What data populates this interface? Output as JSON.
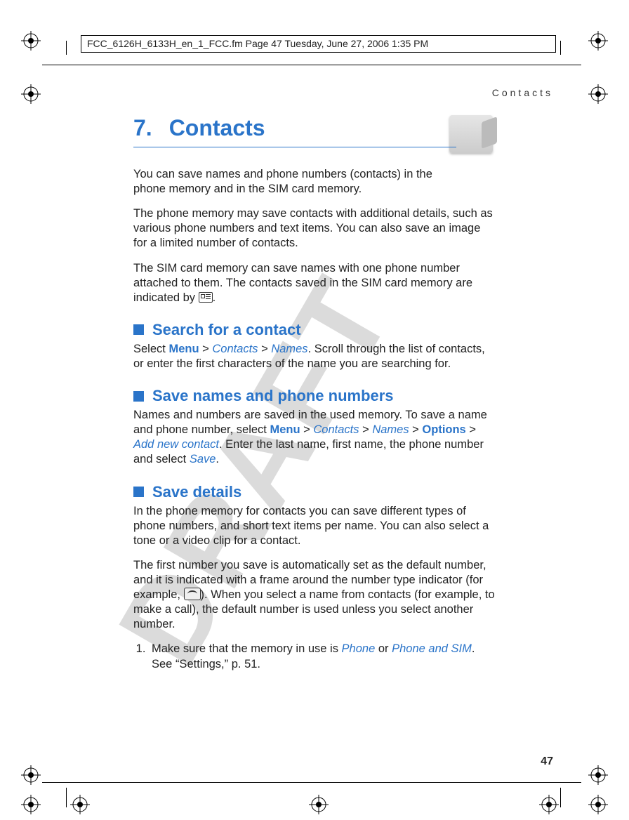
{
  "header": "FCC_6126H_6133H_en_1_FCC.fm  Page 47  Tuesday, June 27, 2006  1:35 PM",
  "running_header": "Contacts",
  "chapter": {
    "num": "7.",
    "title": "Contacts"
  },
  "watermark": "DRAFT",
  "p1": "You can save names and phone numbers (contacts) in the phone memory and in the SIM card memory.",
  "p2": "The phone memory may save contacts with additional details, such as various phone numbers and text items. You can also save an image for a limited number of contacts.",
  "p3a": "The SIM card memory can save names with one phone number attached to them. The contacts saved in the SIM card memory are indicated by ",
  "p3b": ".",
  "sec1": {
    "title": "Search for a contact"
  },
  "p4a": "Select ",
  "p4b": " > ",
  "p4c": " > ",
  "p4d": ". Scroll through the list of contacts, or enter the first characters of the name you are searching for.",
  "menu": "Menu",
  "contacts": "Contacts",
  "names": "Names",
  "options": "Options",
  "addnew": "Add new contact",
  "save": "Save",
  "phone": "Phone",
  "phone_and_sim": "Phone and SIM",
  "sec2": {
    "title": "Save names and phone numbers"
  },
  "p5a": "Names and numbers are saved in the used memory. To save a name and phone number, select ",
  "p5b": " > ",
  "p5c": " > ",
  "p5d": " > ",
  "p5e": " > ",
  "p5f": ". Enter the last name, first name, the phone number and select ",
  "p5g": ".",
  "sec3": {
    "title": "Save details"
  },
  "p6": "In the phone memory for contacts you can save different types of phone numbers, and short text items per name. You can also select a tone or a video clip for a contact.",
  "p7a": "The first number you save is automatically set as the default number, and it is indicated with a frame around the number type indicator (for example, ",
  "p7b": "). When you select a name from contacts (for example, to make a call), the default number is used unless you select another number.",
  "step1a": "Make sure that the memory in use is ",
  "step1b": " or ",
  "step1c": ". See “Settings,” p. 51.",
  "page_num": "47"
}
